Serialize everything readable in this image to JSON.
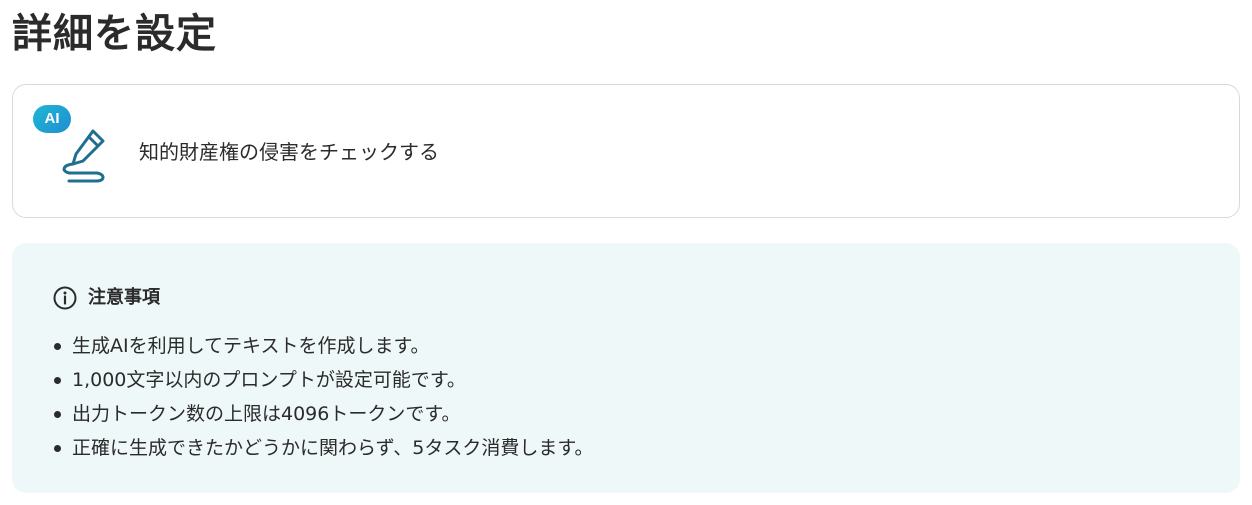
{
  "page": {
    "title": "詳細を設定"
  },
  "action_card": {
    "badge": "AI",
    "label": "知的財産権の侵害をチェックする",
    "icon": "pen-signature-icon",
    "colors": {
      "badge_start": "#1fb6d4",
      "badge_end": "#1f8fd1",
      "icon_stroke": "#1f6f8f"
    }
  },
  "notice": {
    "icon": "info-icon",
    "title": "注意事項",
    "items": [
      "生成AIを利用してテキストを作成します。",
      "1,000文字以内のプロンプトが設定可能です。",
      "出力トークン数の上限は4096トークンです。",
      "正確に生成できたかどうかに関わらず、5タスク消費します。"
    ],
    "colors": {
      "background": "#eff8f8"
    }
  }
}
